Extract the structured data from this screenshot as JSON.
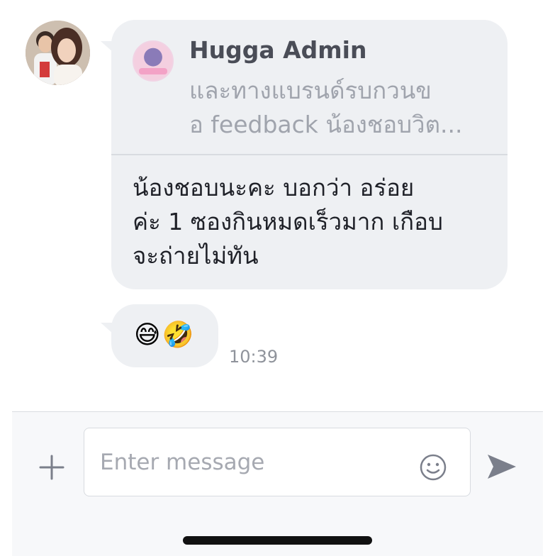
{
  "chat": {
    "avatar_icon": "user-avatar-photo",
    "reply_message": {
      "quote": {
        "logo_icon": "hugga-brand-logo",
        "sender": "Hugga Admin",
        "preview": "และทางแบรนด์รบกวนข\nอ feedback น้องชอบวิต..."
      },
      "text": "น้องชอบนะคะ บอกว่า อร่อย\nค่ะ 1 ซองกินหมดเร็วมาก เกือบ\nจะถ่ายไม่ทัน"
    },
    "emoji_message": {
      "text": "😅🤣",
      "time": "10:39"
    }
  },
  "input_bar": {
    "plus_icon": "plus-icon",
    "placeholder": "Enter message",
    "emoji_icon": "smile-icon",
    "send_icon": "send-icon"
  },
  "colors": {
    "bubble": "#eef0f3",
    "icon_gray": "#7b7f8b",
    "text_dark": "#1f2128"
  }
}
